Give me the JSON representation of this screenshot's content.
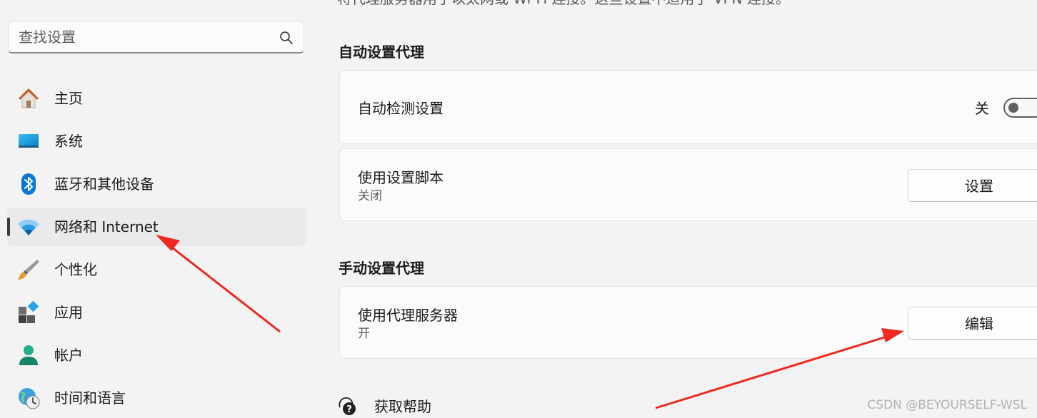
{
  "search": {
    "placeholder": "查找设置"
  },
  "sidebar": {
    "items": [
      {
        "label": "主页",
        "icon": "home-icon"
      },
      {
        "label": "系统",
        "icon": "system-icon"
      },
      {
        "label": "蓝牙和其他设备",
        "icon": "bluetooth-icon"
      },
      {
        "label": "网络和 Internet",
        "icon": "wifi-icon",
        "selected": true
      },
      {
        "label": "个性化",
        "icon": "brush-icon"
      },
      {
        "label": "应用",
        "icon": "apps-icon"
      },
      {
        "label": "帐户",
        "icon": "account-icon"
      },
      {
        "label": "时间和语言",
        "icon": "globe-clock-icon"
      }
    ]
  },
  "main": {
    "top_description": "将代理服务器用于以太网或 Wi-Fi 连接。这些设置不适用于 VPN 连接。",
    "auto_section": {
      "title": "自动设置代理",
      "detect": {
        "title": "自动检测设置",
        "toggle_label": "关",
        "toggle_on": false
      },
      "script": {
        "title": "使用设置脚本",
        "sub": "关闭",
        "button": "设置"
      }
    },
    "manual_section": {
      "title": "手动设置代理",
      "proxy": {
        "title": "使用代理服务器",
        "sub": "开",
        "button": "编辑"
      }
    },
    "help": {
      "label": "获取帮助",
      "icon": "help-chat-icon"
    }
  },
  "watermark": "CSDN @BEYOURSELF-WSL",
  "colors": {
    "accent": "#0067c0",
    "annotation_arrow": "#f0281e"
  }
}
